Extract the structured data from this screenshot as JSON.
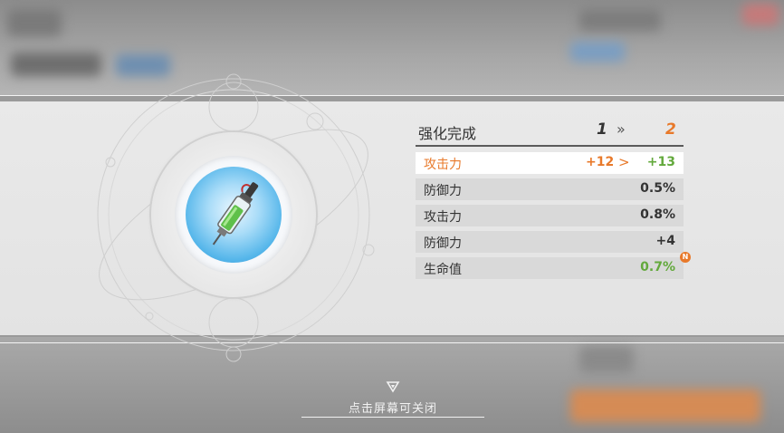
{
  "panel": {
    "title": "强化完成",
    "level_from": "1",
    "level_to": "2",
    "level_arrow": "»"
  },
  "stats": [
    {
      "name": "攻击力",
      "old": "+12",
      "arrow": ">",
      "value": "+13",
      "highlighted": true
    },
    {
      "name": "防御力",
      "value": "0.5%"
    },
    {
      "name": "攻击力",
      "value": "0.8%"
    },
    {
      "name": "防御力",
      "value": "+4"
    },
    {
      "name": "生命值",
      "value": "0.7%",
      "new_badge": "N"
    }
  ],
  "footer": {
    "close_hint": "点击屏幕可关闭",
    "close_icon": "triangle-down-icon"
  },
  "colors": {
    "accent": "#e8792a",
    "new_value": "#63a93c",
    "orb": "#55b6ea"
  },
  "item": {
    "icon": "syringe-icon"
  }
}
